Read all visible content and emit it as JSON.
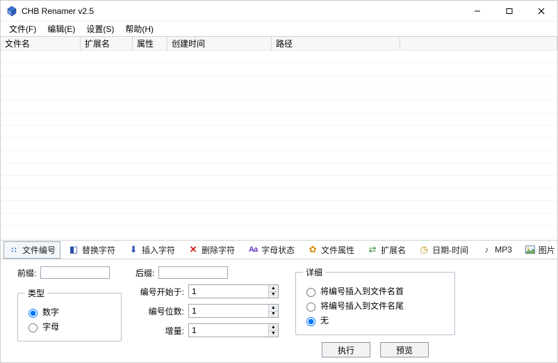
{
  "window": {
    "title": "CHB Renamer v2.5"
  },
  "menu": {
    "file": "文件(F)",
    "edit": "编辑(E)",
    "settings": "设置(S)",
    "help": "帮助(H)"
  },
  "columns": {
    "filename": "文件名",
    "ext": "扩展名",
    "attr": "属性",
    "created": "创建时间",
    "path": "路径"
  },
  "tabs": {
    "numbering": "文件编号",
    "replace": "替换字符",
    "insert": "插入字符",
    "delete": "删除字符",
    "case": "字母状态",
    "attributes": "文件属性",
    "extension": "扩展名",
    "datetime": "日期-时间",
    "mp3": "MP3",
    "image": "图片"
  },
  "form": {
    "prefix_label": "前缀:",
    "suffix_label": "后缀:",
    "prefix_value": "",
    "suffix_value": "",
    "type_legend": "类型",
    "type_number": "数字",
    "type_letter": "字母",
    "start_label": "编号开始于:",
    "start_value": "1",
    "digits_label": "编号位数:",
    "digits_value": "1",
    "step_label": "增量:",
    "step_value": "1",
    "detail_legend": "详细",
    "detail_front": "将编号插入到文件名首",
    "detail_end": "将编号插入到文件名尾",
    "detail_none": "无",
    "btn_execute": "执行",
    "btn_preview": "预览"
  }
}
